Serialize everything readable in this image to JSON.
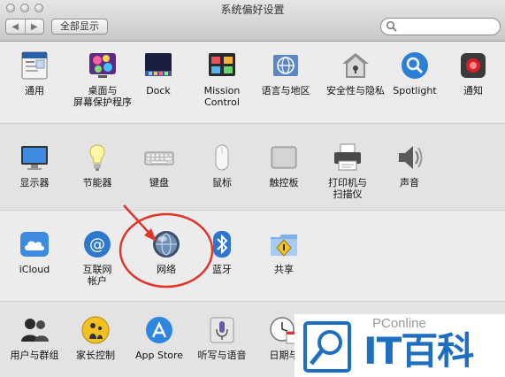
{
  "window": {
    "title": "系统偏好设置"
  },
  "toolbar": {
    "back": "◀",
    "forward": "▶",
    "show_all": "全部显示"
  },
  "rows": [
    [
      {
        "id": "general",
        "label": "通用",
        "icon": "general-icon"
      },
      {
        "id": "desktop",
        "label": "桌面与\n屏幕保护程序",
        "icon": "desktop-screensaver-icon"
      },
      {
        "id": "dock",
        "label": "Dock",
        "icon": "dock-icon"
      },
      {
        "id": "mission",
        "label": "Mission\nControl",
        "icon": "mission-control-icon"
      },
      {
        "id": "language",
        "label": "语言与地区",
        "icon": "language-region-icon"
      },
      {
        "id": "security",
        "label": "安全性与隐私",
        "icon": "security-house-icon"
      },
      {
        "id": "spotlight",
        "label": "Spotlight",
        "icon": "spotlight-icon"
      },
      {
        "id": "notifications",
        "label": "通知",
        "icon": "notifications-icon"
      }
    ],
    [
      {
        "id": "displays",
        "label": "显示器",
        "icon": "display-icon"
      },
      {
        "id": "energy",
        "label": "节能器",
        "icon": "lightbulb-icon"
      },
      {
        "id": "keyboard",
        "label": "键盘",
        "icon": "keyboard-icon"
      },
      {
        "id": "mouse",
        "label": "鼠标",
        "icon": "mouse-icon"
      },
      {
        "id": "trackpad",
        "label": "触控板",
        "icon": "trackpad-icon"
      },
      {
        "id": "printers",
        "label": "打印机与\n扫描仪",
        "icon": "printer-icon"
      },
      {
        "id": "sound",
        "label": "声音",
        "icon": "speaker-icon"
      }
    ],
    [
      {
        "id": "icloud",
        "label": "iCloud",
        "icon": "icloud-icon"
      },
      {
        "id": "internet",
        "label": "互联网\n帐户",
        "icon": "at-sign-icon"
      },
      {
        "id": "network",
        "label": "网络",
        "icon": "network-globe-icon"
      },
      {
        "id": "bluetooth",
        "label": "蓝牙",
        "icon": "bluetooth-icon"
      },
      {
        "id": "sharing",
        "label": "共享",
        "icon": "sharing-folder-icon"
      }
    ],
    [
      {
        "id": "users",
        "label": "用户与群组",
        "icon": "users-icon"
      },
      {
        "id": "parental",
        "label": "家长控制",
        "icon": "parental-controls-icon"
      },
      {
        "id": "appstore",
        "label": "App Store",
        "icon": "app-store-icon"
      },
      {
        "id": "dictation",
        "label": "听写与语音",
        "icon": "microphone-icon"
      },
      {
        "id": "datetime",
        "label": "日期与",
        "icon": "clock-calendar-icon"
      }
    ]
  ],
  "watermark": {
    "small": "PConline",
    "big": "IT百科"
  },
  "colors": {
    "accent": "#1f6fc0",
    "annotation": "#e0362b"
  }
}
